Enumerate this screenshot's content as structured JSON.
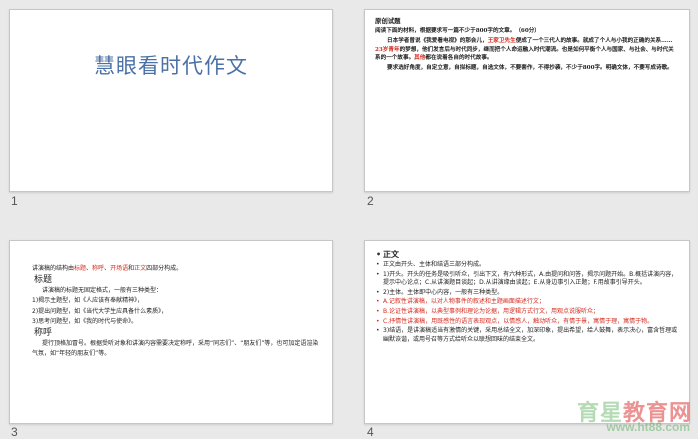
{
  "slides": [
    {
      "number": "1",
      "title": "慧眼看时代作文"
    },
    {
      "number": "2",
      "heading": "原创试题",
      "prompt": "阅读下面的材料，根据要求写一篇不少于800字的文章。（60分）",
      "para1": [
        {
          "t": "日本学者曾说《我爱看电视》的那会儿，",
          "hl": false
        },
        {
          "t": "王家卫先生",
          "hl": true
        },
        {
          "t": "便成了一个三代人的故事。就成了个人与小我的正确的关系……",
          "hl": false
        },
        {
          "t": "23岁青年",
          "hl": true
        },
        {
          "t": "的梦想，他们发言后与时代同步，继而把个人命运融入时代潮流。也是如何平衡个人与国家、与社会、与时代关系的一个故事。",
          "hl": false
        },
        {
          "t": "其他",
          "hl": true
        },
        {
          "t": "都在说着各自的时代故事。",
          "hl": false
        }
      ],
      "para2": "要求选好角度，自定立意，自拟标题，自选文体，不要套作，不得抄袭，不少于800字。明确文体，不要写成诗歌。"
    },
    {
      "number": "3",
      "intro": [
        {
          "t": "讲演稿的结构由",
          "hl": false
        },
        {
          "t": "标题",
          "hl": true
        },
        {
          "t": "、",
          "hl": false
        },
        {
          "t": "称呼",
          "hl": true
        },
        {
          "t": "、",
          "hl": false
        },
        {
          "t": "开场语",
          "hl": true
        },
        {
          "t": "和",
          "hl": false
        },
        {
          "t": "正文",
          "hl": true
        },
        {
          "t": "四部分构成。",
          "hl": false
        }
      ],
      "sub1": "标题",
      "lines1": [
        "讲演稿的标题无固定格式，一般有三种类型：",
        "1)揭示主题型，如《人应该有奉献精神》，",
        "2)提出问题型，如《当代大学生应具备什么素质》，",
        "3)思考问题型，如《我的时代与使命》。"
      ],
      "sub2": "称呼",
      "lines2": [
        "提行顶格加冒号。根据受听对象和讲演内容需要决定称呼，采用“同志们”、“朋友们”等，也可加定语渲染气氛，如“年轻的朋友们”等。"
      ]
    },
    {
      "number": "4",
      "heading": "正文",
      "bullets": [
        {
          "t": "正文由开头、主体和结语三部分构成。",
          "red": false
        },
        {
          "t": "1)开头。开头的任务是吸引听众，引出下文，有六种形式，A.由提问和问答，揭示问题开始。B.概括讲演内容，提示中心论点；C.从讲演题目谈起；D.从讲演缘由谈起；E.从身边事引入正题；F.用故事引导开头。",
          "red": false
        },
        {
          "t": "2)主体。主体即中心内容，一般有三种类型。",
          "red": false
        },
        {
          "t": "A.记叙性讲演稿，以对人物事件的叙述和主题画面描述行文；",
          "red": true
        },
        {
          "t": "B.论证性讲演稿，以典型事例和理论为论据，用逻辑方式行文，用观点说服听众；",
          "red": true
        },
        {
          "t": "C.抒情性讲演稿，用既感性的语言表现观点，以情感人，触动听众，有情于景，寓情于理，寓情于物。",
          "red": true
        },
        {
          "t": "3)结语，是讲演稿适当有激情的关键，采用总结全文，加深印象，提出希望，给人鼓舞，表示决心，富含哲理或幽默诙谐，或用号召等方式给听众以联想回味的结束全文。",
          "red": false
        }
      ]
    }
  ],
  "watermark": {
    "text_a": "育星",
    "text_b": "教育网",
    "url": "www.ht88.com"
  },
  "colors": {
    "title_blue": "#4a71a6",
    "highlight_red": "#d42a1e"
  }
}
